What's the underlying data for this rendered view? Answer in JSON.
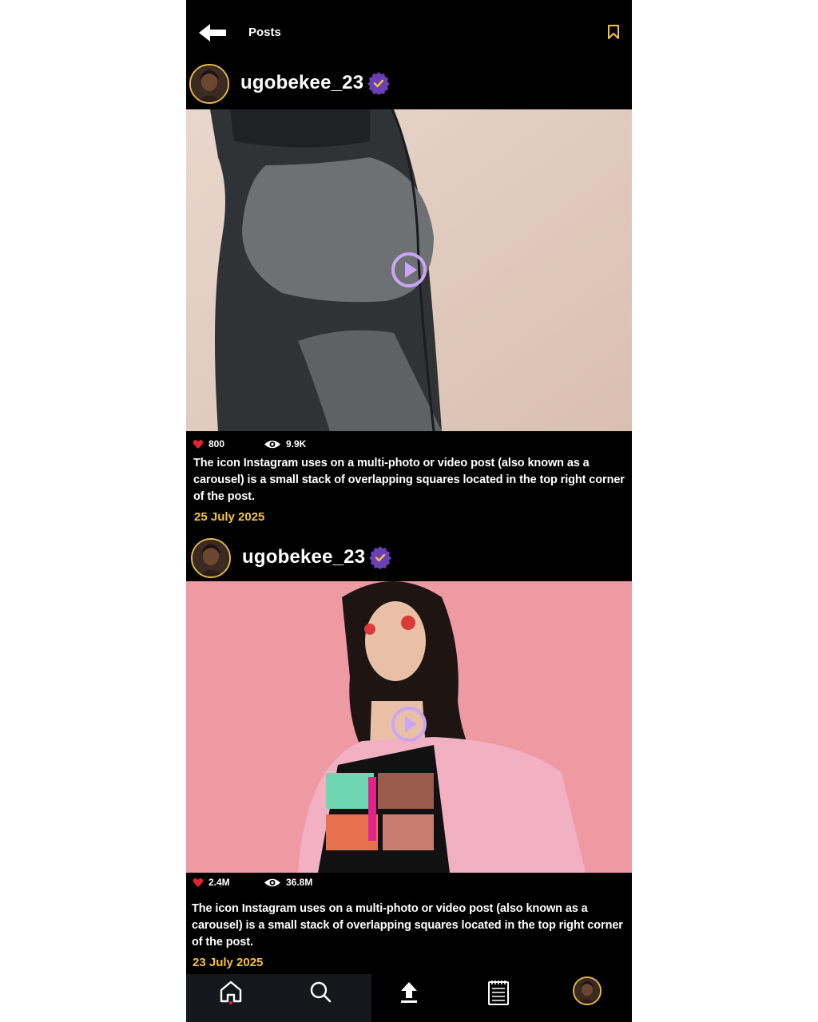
{
  "header": {
    "title": "Posts",
    "back_icon": "arrow-left-icon",
    "bookmark_icon": "bookmark-icon",
    "accent_color": "#f6c33a"
  },
  "posts": [
    {
      "username": "ugobekee_23",
      "verified": true,
      "likes": "800",
      "views": "9.9K",
      "caption": "The icon Instagram uses on a multi-photo or video post (also known as a carousel) is a small stack of overlapping squares located in the top right corner of the post.",
      "date": "25 July 2025",
      "media_type": "video"
    },
    {
      "username": "ugobekee_23",
      "verified": true,
      "likes": "2.4M",
      "views": "36.8M",
      "caption": "The icon Instagram uses on a multi-photo or video post (also known as a carousel) is a small stack of overlapping squares located in the top right corner of the post.",
      "date": "23 July 2025",
      "media_type": "video"
    }
  ],
  "bottom_nav": {
    "items": [
      "home-icon",
      "search-icon",
      "upload-icon",
      "notes-icon",
      "profile-avatar"
    ],
    "active": "home-icon"
  },
  "colors": {
    "like": "#e0242f",
    "verified_badge": "#6b3fb5",
    "play_button": "#c9a6f5",
    "date": "#f6c33a"
  }
}
